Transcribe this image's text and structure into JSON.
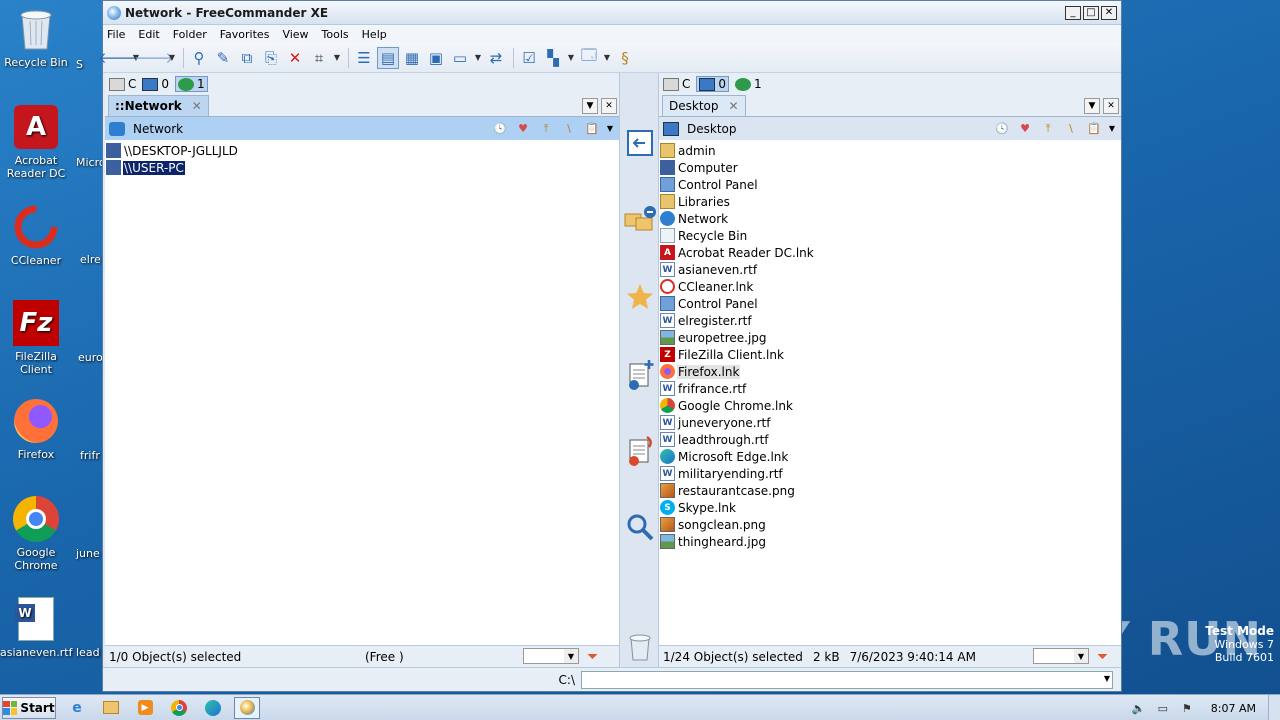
{
  "desktop": {
    "icons": [
      {
        "label": "Recycle Bin"
      },
      {
        "label": "Acrobat Reader DC"
      },
      {
        "label": "CCleaner"
      },
      {
        "label": "FileZilla Client"
      },
      {
        "label": "Firefox"
      },
      {
        "label": "Google Chrome"
      },
      {
        "label": "asianeven.rtf"
      }
    ],
    "partial_labels": [
      "S",
      "Micro",
      "elre",
      "euro",
      "frifr",
      "june",
      "lead"
    ]
  },
  "window": {
    "title": "Network - FreeCommander XE",
    "menu": [
      "File",
      "Edit",
      "Folder",
      "Favorites",
      "View",
      "Tools",
      "Help"
    ]
  },
  "left_panel": {
    "drives": [
      {
        "label": "C"
      },
      {
        "label": "0"
      },
      {
        "label": "1"
      }
    ],
    "tab": "::Network",
    "path": "Network",
    "files": [
      "\\\\DESKTOP-JGLLJLD",
      "\\\\USER-PC"
    ],
    "status": "1/0 Object(s) selected",
    "free": "(Free )"
  },
  "right_panel": {
    "drives": [
      {
        "label": "C"
      },
      {
        "label": "0"
      },
      {
        "label": "1"
      }
    ],
    "tab": "Desktop",
    "path": "Desktop",
    "files": [
      {
        "name": "admin",
        "icon": "user-folder"
      },
      {
        "name": "Computer",
        "icon": "computer"
      },
      {
        "name": "Control Panel",
        "icon": "control-panel"
      },
      {
        "name": "Libraries",
        "icon": "libraries"
      },
      {
        "name": "Network",
        "icon": "network"
      },
      {
        "name": "Recycle Bin",
        "icon": "recycle-bin"
      },
      {
        "name": "Acrobat Reader DC.lnk",
        "icon": "acrobat"
      },
      {
        "name": "asianeven.rtf",
        "icon": "rtf"
      },
      {
        "name": "CCleaner.lnk",
        "icon": "ccleaner"
      },
      {
        "name": "Control Panel",
        "icon": "control-panel"
      },
      {
        "name": "elregister.rtf",
        "icon": "rtf"
      },
      {
        "name": "europetree.jpg",
        "icon": "jpg"
      },
      {
        "name": "FileZilla Client.lnk",
        "icon": "filezilla"
      },
      {
        "name": "Firefox.lnk",
        "icon": "firefox"
      },
      {
        "name": "frifrance.rtf",
        "icon": "rtf"
      },
      {
        "name": "Google Chrome.lnk",
        "icon": "chrome"
      },
      {
        "name": "juneveryone.rtf",
        "icon": "rtf"
      },
      {
        "name": "leadthrough.rtf",
        "icon": "rtf"
      },
      {
        "name": "Microsoft Edge.lnk",
        "icon": "edge"
      },
      {
        "name": "militaryending.rtf",
        "icon": "rtf"
      },
      {
        "name": "restaurantcase.png",
        "icon": "png"
      },
      {
        "name": "Skype.lnk",
        "icon": "skype"
      },
      {
        "name": "songclean.png",
        "icon": "png"
      },
      {
        "name": "thingheard.jpg",
        "icon": "jpg"
      }
    ],
    "status": "1/24 Object(s) selected",
    "size": "2 kB",
    "date": "7/6/2023 9:40:14 AM"
  },
  "cmdline": {
    "label": "C:\\"
  },
  "taskbar": {
    "start": "Start",
    "clock": "8:07 AM"
  },
  "watermark": {
    "brand": "ANY RUN",
    "mode": "Test Mode",
    "os": "Windows 7",
    "build": "Build 7601"
  },
  "colors": {
    "selection": "#0b246a",
    "active_path": "#aed0f3",
    "accent": "#2d6bb3"
  }
}
